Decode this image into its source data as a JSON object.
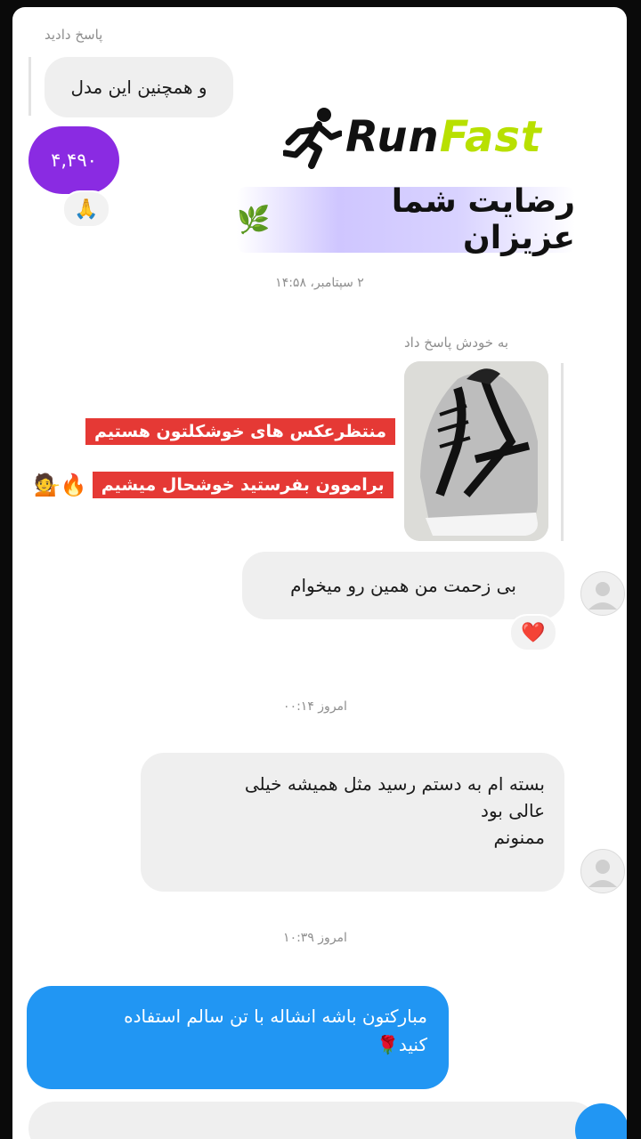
{
  "thread": {
    "reply_label_top": "پاسخ دادید",
    "bubble_model": "و همچنین این مدل",
    "price_bubble": "۴,۴۹۰",
    "price_reaction": "🙏",
    "timestamp_1": "۲ سپتامبر، ۱۴:۵۸",
    "reply_label_self": "به خودش پاسخ داد",
    "msg_want": "بی زحمت من همین رو میخوام",
    "msg_want_reaction": "❤️",
    "timestamp_2": "امروز ۰۰:۱۴",
    "msg_received_line1": "بسته ام به دستم رسید مثل همیشه خیلی",
    "msg_received_line2": "عالی بود",
    "msg_received_line3": "ممنونم",
    "timestamp_3": "امروز ۱۰:۳۹",
    "msg_sent_line1": "مبارکتون باشه انشاله با تن سالم استفاده",
    "msg_sent_line2": "کنید🌹"
  },
  "overlay": {
    "brand_part1": "Run",
    "brand_part2": "Fast",
    "satisfaction_title": "رضایت شما عزیزان",
    "satisfaction_icon": "🌿",
    "promo_line1": "منتظرعکس های خوشکلتون هستیم",
    "promo_line2": "براموون بفرستید خوشحال میشیم",
    "promo_emoji": "💁🔥"
  },
  "colors": {
    "price_purple": "#8a2be2",
    "sent_blue": "#2196f3",
    "brand_green": "#b8e000",
    "promo_red": "#e53935"
  }
}
